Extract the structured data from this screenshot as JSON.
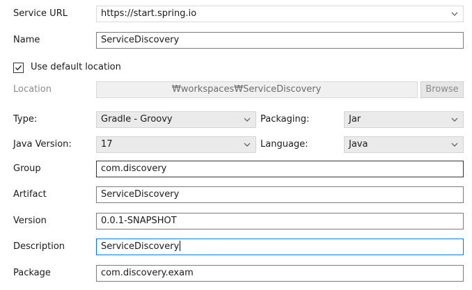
{
  "form": {
    "service_url": {
      "label": "Service URL",
      "value": "https://start.spring.io"
    },
    "name": {
      "label": "Name",
      "value": "ServiceDiscovery"
    },
    "use_default_location": {
      "label": "Use default location",
      "checked": true
    },
    "location": {
      "label": "Location",
      "value": "₩workspaces₩ServiceDiscovery",
      "browse_label": "Browse"
    },
    "type": {
      "label": "Type:",
      "value": "Gradle - Groovy"
    },
    "packaging": {
      "label": "Packaging:",
      "value": "Jar"
    },
    "java_version": {
      "label": "Java Version:",
      "value": "17"
    },
    "language": {
      "label": "Language:",
      "value": "Java"
    },
    "group": {
      "label": "Group",
      "value": "com.discovery"
    },
    "artifact": {
      "label": "Artifact",
      "value": "ServiceDiscovery"
    },
    "version": {
      "label": "Version",
      "value": "0.0.1-SNAPSHOT"
    },
    "description": {
      "label": "Description",
      "value": "ServiceDiscovery"
    },
    "package": {
      "label": "Package",
      "value": "com.discovery.exam"
    }
  },
  "icons": {
    "dropdown": "chevron-down-icon",
    "check": "check-icon"
  }
}
